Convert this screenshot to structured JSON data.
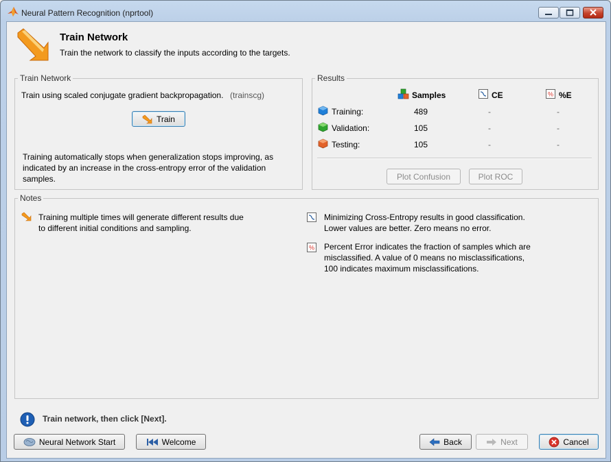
{
  "window": {
    "title": "Neural Pattern Recognition (nprtool)"
  },
  "header": {
    "title": "Train Network",
    "subtitle": "Train the network to classify the inputs according to the targets."
  },
  "train_panel": {
    "title": "Train Network",
    "method": "Train using scaled conjugate gradient backpropagation.",
    "method_code": "(trainscg)",
    "train_button": "Train",
    "description_lines": [
      "Training automatically stops when generalization stops improving, as",
      "indicated by an increase in the cross-entropy error of the validation",
      "samples."
    ]
  },
  "results_panel": {
    "title": "Results",
    "columns": {
      "samples": "Samples",
      "ce": "CE",
      "pe": "%E"
    },
    "rows": [
      {
        "label": "Training:",
        "samples": "489",
        "ce": "-",
        "pe": "-",
        "color": "#1f7fd8"
      },
      {
        "label": "Validation:",
        "samples": "105",
        "ce": "-",
        "pe": "-",
        "color": "#2fa52f"
      },
      {
        "label": "Testing:",
        "samples": "105",
        "ce": "-",
        "pe": "-",
        "color": "#e2622a"
      }
    ],
    "plot_confusion": "Plot Confusion",
    "plot_roc": "Plot ROC"
  },
  "notes_panel": {
    "title": "Notes",
    "note1": [
      "Training multiple times will generate different results due",
      "to different initial conditions and sampling."
    ],
    "note2": [
      "Minimizing Cross-Entropy results in good classification.",
      "Lower values are better. Zero means no error."
    ],
    "note3": [
      "Percent Error  indicates the fraction of samples which are",
      "misclassified. A value of 0 means no misclassifications,",
      "100 indicates maximum misclassifications."
    ]
  },
  "status": {
    "message": "Train network, then click [Next]."
  },
  "footer": {
    "nn_start": "Neural Network Start",
    "welcome": "Welcome",
    "back": "Back",
    "next": "Next",
    "cancel": "Cancel"
  },
  "colors": {
    "accent": "#3c7fb1",
    "arrow_orange": "#f39a1e",
    "cancel_red": "#d9342b",
    "info_blue": "#1e5fb4"
  }
}
